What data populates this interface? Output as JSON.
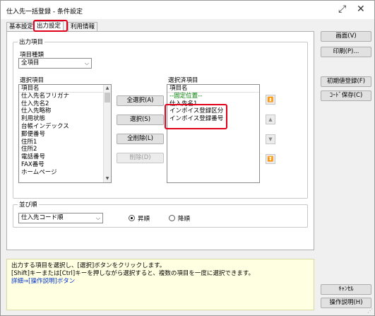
{
  "window": {
    "title": "仕入先一括登録 - 条件設定"
  },
  "tabs": [
    {
      "label": "基本設定"
    },
    {
      "label": "出力設定"
    },
    {
      "label": "利用情報"
    }
  ],
  "output": {
    "group_label": "出力項目",
    "item_type_label": "項目種類",
    "item_type_value": "全項目",
    "available_label": "選択項目",
    "available_items": [
      "項目名",
      "仕入先名フリガナ",
      "仕入先名2",
      "仕入先略称",
      "利用状態",
      "台帳インデックス",
      "郵便番号",
      "住所1",
      "住所2",
      "電話番号",
      "FAX番号",
      "ホームページ"
    ],
    "selected_label": "選択済項目",
    "selected_items": [
      "項目名",
      "--固定位置--",
      "仕入先名1",
      "インボイス登録区分",
      "インボイス登録番号"
    ],
    "buttons": {
      "select_all": "全選択(A)",
      "select": "選択(S)",
      "deselect_all": "全削除(L)",
      "delete": "削除(D)"
    }
  },
  "sort": {
    "group_label": "並び順",
    "value": "仕入先コード順",
    "ascending": "昇順",
    "descending": "降順",
    "selected": "ascending"
  },
  "side_buttons": {
    "screen": "画面(V)",
    "print": "印刷(P)...",
    "register_default": "初期値登録(F)",
    "save_code": "ｺｰﾄﾞ保存(C)",
    "cancel": "ｷｬﾝｾﾙ",
    "help": "操作説明(H)"
  },
  "hint": {
    "line1": "出力する項目を選択し、[選択]ボタンをクリックします。",
    "line2": "[Shift]キーまたは[Ctrl]キーを押しながら選択すると、複数の項目を一度に選択できます。",
    "line3": "詳細⇒[操作説明]ボタン"
  }
}
